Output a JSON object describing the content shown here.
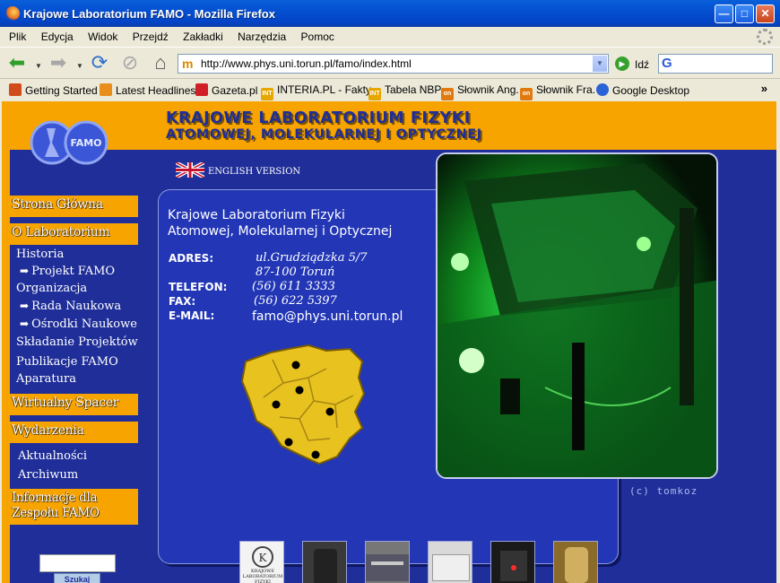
{
  "window": {
    "title": "Krajowe Laboratorium FAMO - Mozilla Firefox"
  },
  "menu": [
    "Plik",
    "Edycja",
    "Widok",
    "Przejdź",
    "Zakładki",
    "Narzędzia",
    "Pomoc"
  ],
  "nav": {
    "url": "http://www.phys.uni.torun.pl/famo/index.html",
    "go_label": "Idź"
  },
  "bookmarks": [
    {
      "label": "Getting Started",
      "icon": "firefox-icon",
      "color": "#d24b1a"
    },
    {
      "label": "Latest Headlines",
      "icon": "rss-icon",
      "color": "#e88e1a"
    },
    {
      "label": "Gazeta.pl",
      "icon": "gazeta-icon",
      "color": "#d01f26"
    },
    {
      "label": "INTERIA.PL - Fakty",
      "icon": "interia-icon",
      "color": "#e6a700"
    },
    {
      "label": "Tabela NBP",
      "icon": "interia-icon",
      "color": "#e6a700"
    },
    {
      "label": "Słownik Ang.",
      "icon": "onet-icon",
      "color": "#e07a10"
    },
    {
      "label": "Słownik Fra.",
      "icon": "onet-icon",
      "color": "#e07a10"
    },
    {
      "label": "Google Desktop",
      "icon": "google-icon",
      "color": "#2a63d6"
    }
  ],
  "site": {
    "title_line1": "KRAJOWE LABORATORIUM FIZYKI",
    "title_line2": "ATOMOWEJ, MOLEKULARNEJ I OPTYCZNEJ",
    "logo_text": "FAMO",
    "english": "ENGLISH VERSION",
    "menu": {
      "home": "Strona Główna",
      "about": "O Laboratorium",
      "historia": "Historia",
      "projekt": "Projekt FAMO",
      "organizacja": "Organizacja",
      "rada": "Rada Naukowa",
      "osrodki": "Ośrodki Naukowe",
      "skladanie": "Składanie Projektów",
      "publikacje": "Publikacje FAMO",
      "aparatura": "Aparatura",
      "spacer": "Wirtualny Spacer",
      "wydarzenia": "Wydarzenia",
      "aktualnosci": "Aktualności",
      "archiwum": "Archiwum",
      "informacje": "Informacje dla Zespołu FAMO"
    },
    "search_button": "Szukaj",
    "lab_name_line1": "Krajowe Laboratorium Fizyki",
    "lab_name_line2": "Atomowej, Molekularnej i Optycznej",
    "contact": {
      "address_label": "ADRES:",
      "address_line1": "ul.Grudziądzka 5/7",
      "address_line2": "87-100 Toruń",
      "phone_label": "TELEFON:",
      "phone": "(56) 611 3333",
      "fax_label": "FAX:",
      "fax": "(56) 622 5397",
      "email_label": "E-MAIL:",
      "email": "famo@phys.uni.torun.pl"
    },
    "credit": "(c) tomkoz",
    "thumb_caption": "KRAJOWE LABORATORIUM FIZYKI ATOMOWEJ"
  }
}
